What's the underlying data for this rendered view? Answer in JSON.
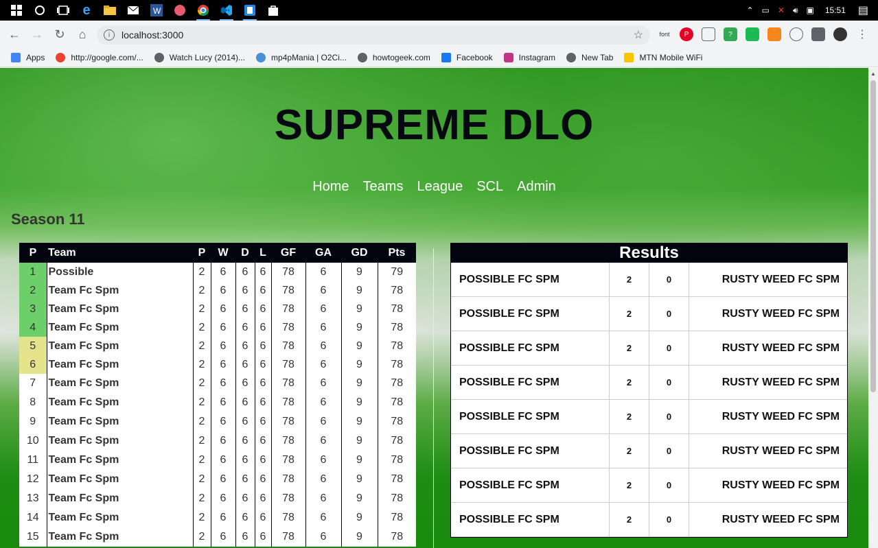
{
  "taskbar": {
    "time": "15:51",
    "icons": [
      "windows-start-icon",
      "cortana-icon",
      "task-view-icon",
      "edge-icon",
      "file-explorer-icon",
      "mail-icon",
      "word-icon",
      "pen-app-icon",
      "chrome-icon",
      "vscode-icon",
      "app-icon",
      "store-icon"
    ]
  },
  "browser": {
    "url": "localhost:3000",
    "extensions": [
      "font",
      "P",
      "",
      "?",
      "",
      "",
      "",
      ""
    ]
  },
  "bookmarks": [
    {
      "label": "Apps",
      "color": "#4285f4"
    },
    {
      "label": "http://google.com/...",
      "color": "#ea4335"
    },
    {
      "label": "Watch Lucy (2014)...",
      "color": "#5f6368"
    },
    {
      "label": "mp4pMania | O2Ci...",
      "color": "#4a90d9"
    },
    {
      "label": "howtogeek.com",
      "color": "#5f6368"
    },
    {
      "label": "Facebook",
      "color": "#1877f2"
    },
    {
      "label": "Instagram",
      "color": "#c13584"
    },
    {
      "label": "New Tab",
      "color": "#5f6368"
    },
    {
      "label": "MTN Mobile WiFi",
      "color": "#f7c600"
    }
  ],
  "site": {
    "title": "SUPREME DLO",
    "nav": [
      "Home",
      "Teams",
      "League",
      "SCL",
      "Admin"
    ],
    "season": "Season 11"
  },
  "league": {
    "headers": [
      "P",
      "Team",
      "P",
      "W",
      "D",
      "L",
      "GF",
      "GA",
      "GD",
      "Pts"
    ],
    "rows": [
      {
        "pos": "1",
        "team": "Possible",
        "p": "2",
        "w": "6",
        "d": "6",
        "l": "6",
        "gf": "78",
        "ga": "6",
        "gd": "9",
        "pts": "79",
        "zone": "cl"
      },
      {
        "pos": "2",
        "team": "Team Fc Spm",
        "p": "2",
        "w": "6",
        "d": "6",
        "l": "6",
        "gf": "78",
        "ga": "6",
        "gd": "9",
        "pts": "78",
        "zone": "cl"
      },
      {
        "pos": "3",
        "team": "Team Fc Spm",
        "p": "2",
        "w": "6",
        "d": "6",
        "l": "6",
        "gf": "78",
        "ga": "6",
        "gd": "9",
        "pts": "78",
        "zone": "cl"
      },
      {
        "pos": "4",
        "team": "Team Fc Spm",
        "p": "2",
        "w": "6",
        "d": "6",
        "l": "6",
        "gf": "78",
        "ga": "6",
        "gd": "9",
        "pts": "78",
        "zone": "cl"
      },
      {
        "pos": "5",
        "team": "Team Fc Spm",
        "p": "2",
        "w": "6",
        "d": "6",
        "l": "6",
        "gf": "78",
        "ga": "6",
        "gd": "9",
        "pts": "78",
        "zone": "el"
      },
      {
        "pos": "6",
        "team": "Team Fc Spm",
        "p": "2",
        "w": "6",
        "d": "6",
        "l": "6",
        "gf": "78",
        "ga": "6",
        "gd": "9",
        "pts": "78",
        "zone": "el"
      },
      {
        "pos": "7",
        "team": "Team Fc Spm",
        "p": "2",
        "w": "6",
        "d": "6",
        "l": "6",
        "gf": "78",
        "ga": "6",
        "gd": "9",
        "pts": "78",
        "zone": ""
      },
      {
        "pos": "8",
        "team": "Team Fc Spm",
        "p": "2",
        "w": "6",
        "d": "6",
        "l": "6",
        "gf": "78",
        "ga": "6",
        "gd": "9",
        "pts": "78",
        "zone": ""
      },
      {
        "pos": "9",
        "team": "Team Fc Spm",
        "p": "2",
        "w": "6",
        "d": "6",
        "l": "6",
        "gf": "78",
        "ga": "6",
        "gd": "9",
        "pts": "78",
        "zone": ""
      },
      {
        "pos": "10",
        "team": "Team Fc Spm",
        "p": "2",
        "w": "6",
        "d": "6",
        "l": "6",
        "gf": "78",
        "ga": "6",
        "gd": "9",
        "pts": "78",
        "zone": ""
      },
      {
        "pos": "11",
        "team": "Team Fc Spm",
        "p": "2",
        "w": "6",
        "d": "6",
        "l": "6",
        "gf": "78",
        "ga": "6",
        "gd": "9",
        "pts": "78",
        "zone": ""
      },
      {
        "pos": "12",
        "team": "Team Fc Spm",
        "p": "2",
        "w": "6",
        "d": "6",
        "l": "6",
        "gf": "78",
        "ga": "6",
        "gd": "9",
        "pts": "78",
        "zone": ""
      },
      {
        "pos": "13",
        "team": "Team Fc Spm",
        "p": "2",
        "w": "6",
        "d": "6",
        "l": "6",
        "gf": "78",
        "ga": "6",
        "gd": "9",
        "pts": "78",
        "zone": ""
      },
      {
        "pos": "14",
        "team": "Team Fc Spm",
        "p": "2",
        "w": "6",
        "d": "6",
        "l": "6",
        "gf": "78",
        "ga": "6",
        "gd": "9",
        "pts": "78",
        "zone": ""
      },
      {
        "pos": "15",
        "team": "Team Fc Spm",
        "p": "2",
        "w": "6",
        "d": "6",
        "l": "6",
        "gf": "78",
        "ga": "6",
        "gd": "9",
        "pts": "78",
        "zone": ""
      }
    ]
  },
  "results": {
    "title": "Results",
    "rows": [
      {
        "home": "POSSIBLE FC SPM",
        "home_score": "2",
        "away_score": "0",
        "away": "RUSTY WEED FC SPM"
      },
      {
        "home": "POSSIBLE FC SPM",
        "home_score": "2",
        "away_score": "0",
        "away": "RUSTY WEED FC SPM"
      },
      {
        "home": "POSSIBLE FC SPM",
        "home_score": "2",
        "away_score": "0",
        "away": "RUSTY WEED FC SPM"
      },
      {
        "home": "POSSIBLE FC SPM",
        "home_score": "2",
        "away_score": "0",
        "away": "RUSTY WEED FC SPM"
      },
      {
        "home": "POSSIBLE FC SPM",
        "home_score": "2",
        "away_score": "0",
        "away": "RUSTY WEED FC SPM"
      },
      {
        "home": "POSSIBLE FC SPM",
        "home_score": "2",
        "away_score": "0",
        "away": "RUSTY WEED FC SPM"
      },
      {
        "home": "POSSIBLE FC SPM",
        "home_score": "2",
        "away_score": "0",
        "away": "RUSTY WEED FC SPM"
      },
      {
        "home": "POSSIBLE FC SPM",
        "home_score": "2",
        "away_score": "0",
        "away": "RUSTY WEED FC SPM"
      }
    ]
  }
}
